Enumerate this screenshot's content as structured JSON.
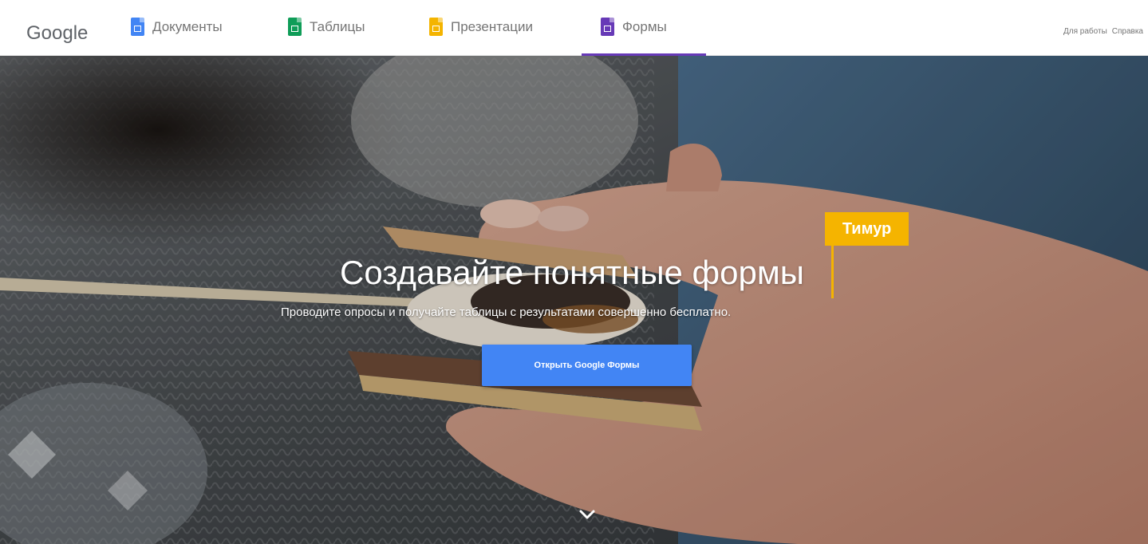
{
  "brand": {
    "logo_text": "Google"
  },
  "nav": {
    "tabs": [
      {
        "label": "Документы",
        "icon": "docs-icon",
        "color": "#4285f4"
      },
      {
        "label": "Таблицы",
        "icon": "sheets-icon",
        "color": "#0f9d58"
      },
      {
        "label": "Презентации",
        "icon": "slides-icon",
        "color": "#f4b400"
      },
      {
        "label": "Формы",
        "icon": "forms-icon",
        "color": "#673ab7",
        "active": true
      }
    ],
    "links": [
      {
        "label": "Для работы"
      },
      {
        "label": "Справка"
      }
    ]
  },
  "hero": {
    "title": "Создавайте понятные формы",
    "subtitle": "Проводите опросы и получайте таблицы с результатами совершенно бесплатно.",
    "cta_label": "Открыть Google Формы",
    "cta_color": "#4285f4",
    "collaborator_cursor": {
      "name": "Тимур",
      "color": "#f5b400"
    },
    "scroll_icon": "chevron-down-icon"
  }
}
